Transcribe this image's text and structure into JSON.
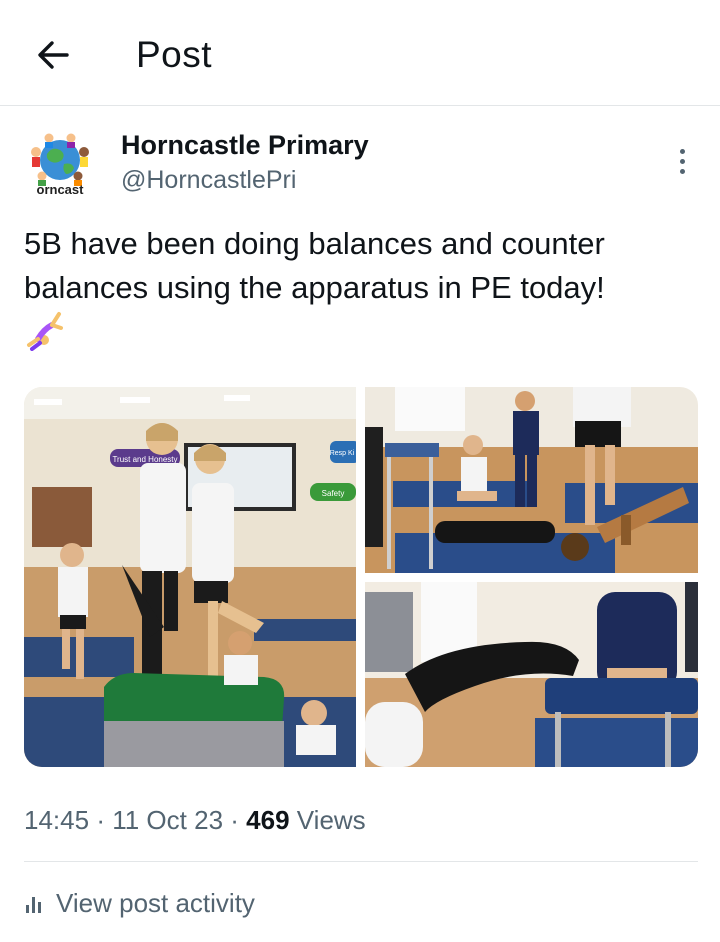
{
  "header": {
    "title": "Post",
    "back_icon": "arrow-left-icon"
  },
  "author": {
    "name": "Horncastle Primary",
    "handle": "@HorncastlePri",
    "avatar_logo_text": "orncast"
  },
  "post": {
    "text": "5B have been doing balances and counter balances using the apparatus in PE today!",
    "emoji": "person-doing-cartwheel-emoji"
  },
  "media": {
    "photo1_signs": [
      "Trust and Honesty",
      "Safety",
      "Resp Ki"
    ]
  },
  "meta": {
    "time": "14:45",
    "separator": "·",
    "date": "11 Oct 23",
    "views_count": "469",
    "views_label": "Views"
  },
  "actions": {
    "view_activity": "View post activity",
    "activity_icon": "bar-chart-icon"
  },
  "colors": {
    "text": "#0f1419",
    "secondary": "#536471",
    "divider": "#e3e6e8"
  }
}
